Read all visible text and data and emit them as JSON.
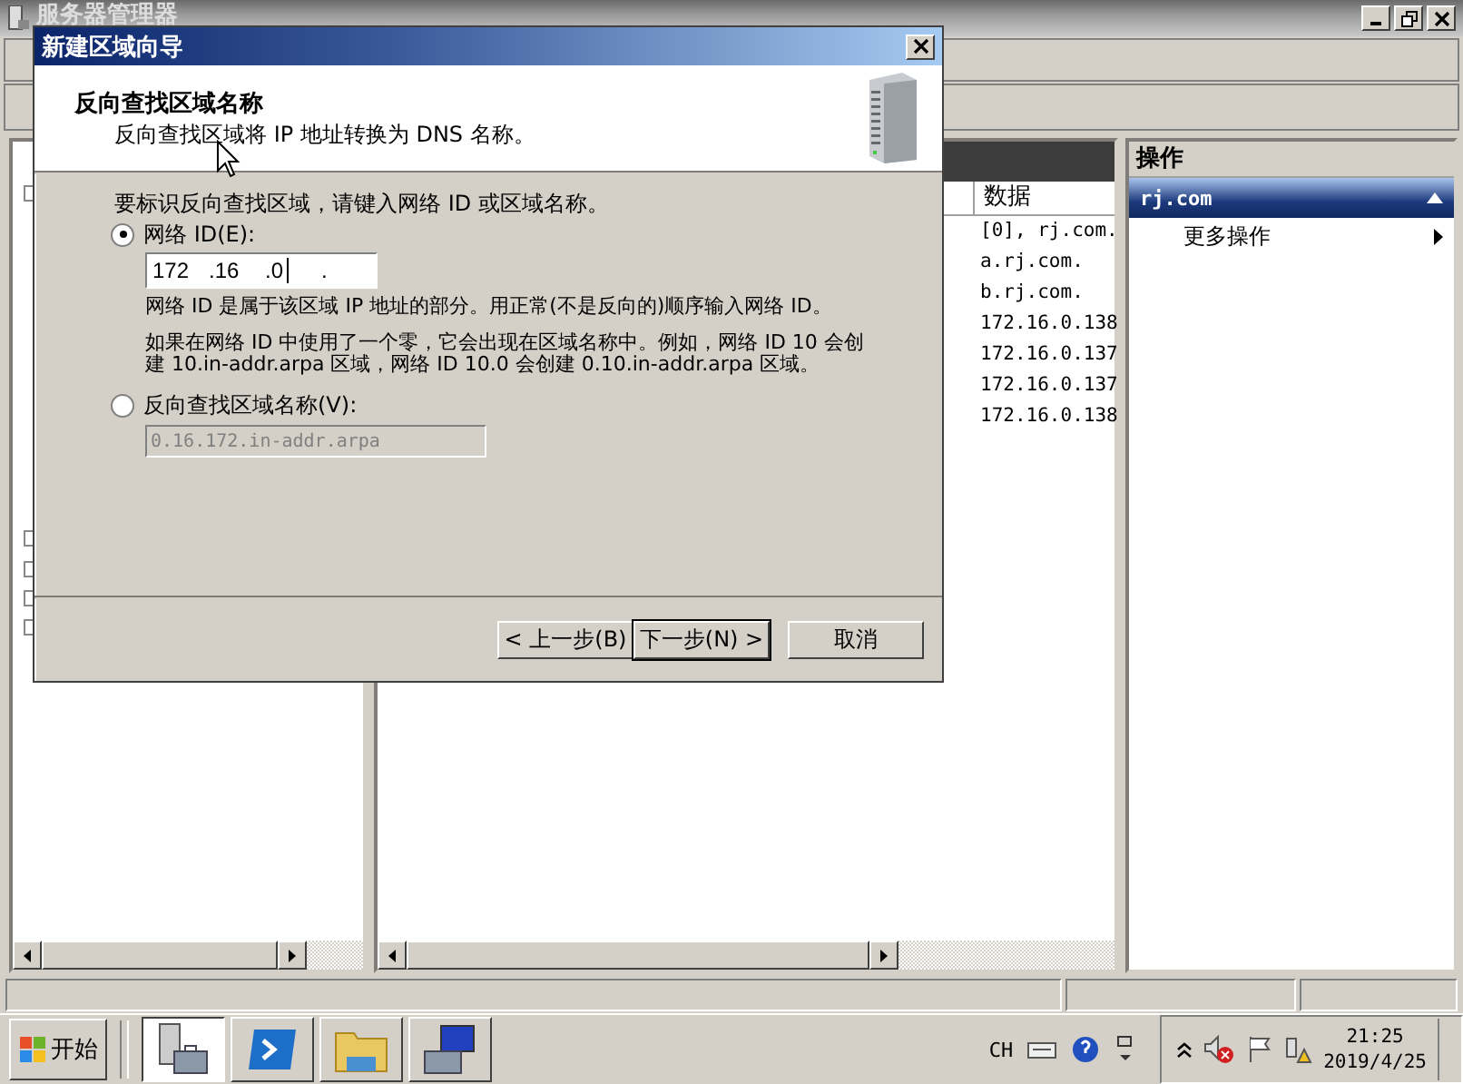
{
  "main_window": {
    "title": "服务器管理器",
    "records": {
      "column": "数据",
      "rows": [
        "[0], rj.com.",
        "a.rj.com.",
        "b.rj.com.",
        "172.16.0.138",
        "172.16.0.137",
        "172.16.0.137",
        "172.16.0.138"
      ]
    },
    "actions_pane": {
      "header": "操作",
      "group": "rj.com",
      "items": [
        {
          "label": "更多操作"
        }
      ]
    }
  },
  "dialog": {
    "title": "新建区域向导",
    "heading": "反向查找区域名称",
    "subheading": "反向查找区域将 IP 地址转换为 DNS 名称。",
    "prompt": "要标识反向查找区域，请键入网络 ID 或区域名称。",
    "options": [
      {
        "label": "网络 ID(E):",
        "selected": true
      },
      {
        "label": "反向查找区域名称(V):",
        "selected": false
      }
    ],
    "network_id": [
      "172",
      ".16",
      ".0",
      "."
    ],
    "help": [
      "网络 ID 是属于该区域 IP 地址的部分。用正常(不是反向的)顺序输入网络 ID。",
      "如果在网络 ID 中使用了一个零，它会出现在区域名称中。例如，网络 ID 10 会创建 10.in-addr.arpa 区域，网络 ID 10.0 会创建 0.10.in-addr.arpa 区域。"
    ],
    "zone_name": {
      "value": "0.16.172.in-addr.arpa",
      "disabled": true
    },
    "buttons": [
      {
        "label": "< 上一步(B)",
        "default": false
      },
      {
        "label": "下一步(N) >",
        "default": true
      },
      {
        "label": "取消",
        "default": false
      }
    ]
  },
  "taskbar": {
    "start": "开始",
    "language": "CH",
    "time": "21:25",
    "date": "2019/4/25"
  }
}
